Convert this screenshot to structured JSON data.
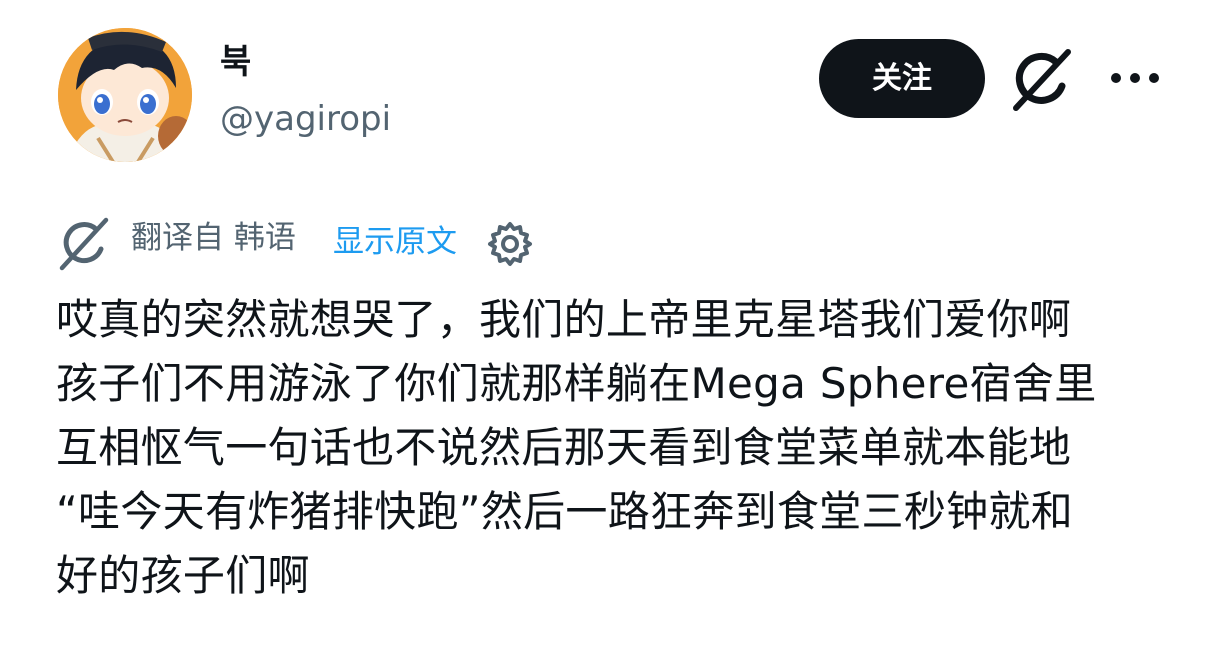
{
  "author": {
    "display_name": "북",
    "handle": "@yagiropi"
  },
  "actions": {
    "follow_label": "关注",
    "grok_icon": "grok-icon",
    "more_icon": "more-icon"
  },
  "translation": {
    "icon": "grok-icon",
    "translated_from": "翻译自 韩语",
    "show_original": "显示原文",
    "settings_icon": "gear-icon"
  },
  "post": {
    "lines": [
      "哎真的突然就想哭了，我们的上帝里克星塔我们爱你啊",
      "孩子们不用游泳了你们就那样躺在Mega Sphere宿舍里",
      "互相怄气一句话也不说然后那天看到食堂菜单就本能地",
      "“哇今天有炸猪排快跑”然后一路狂奔到食堂三秒钟就和",
      "好的孩子们啊"
    ]
  },
  "colors": {
    "text": "#0f1419",
    "secondary": "#536471",
    "link": "#1d9bf0",
    "button_bg": "#0f1419",
    "button_text": "#ffffff"
  }
}
